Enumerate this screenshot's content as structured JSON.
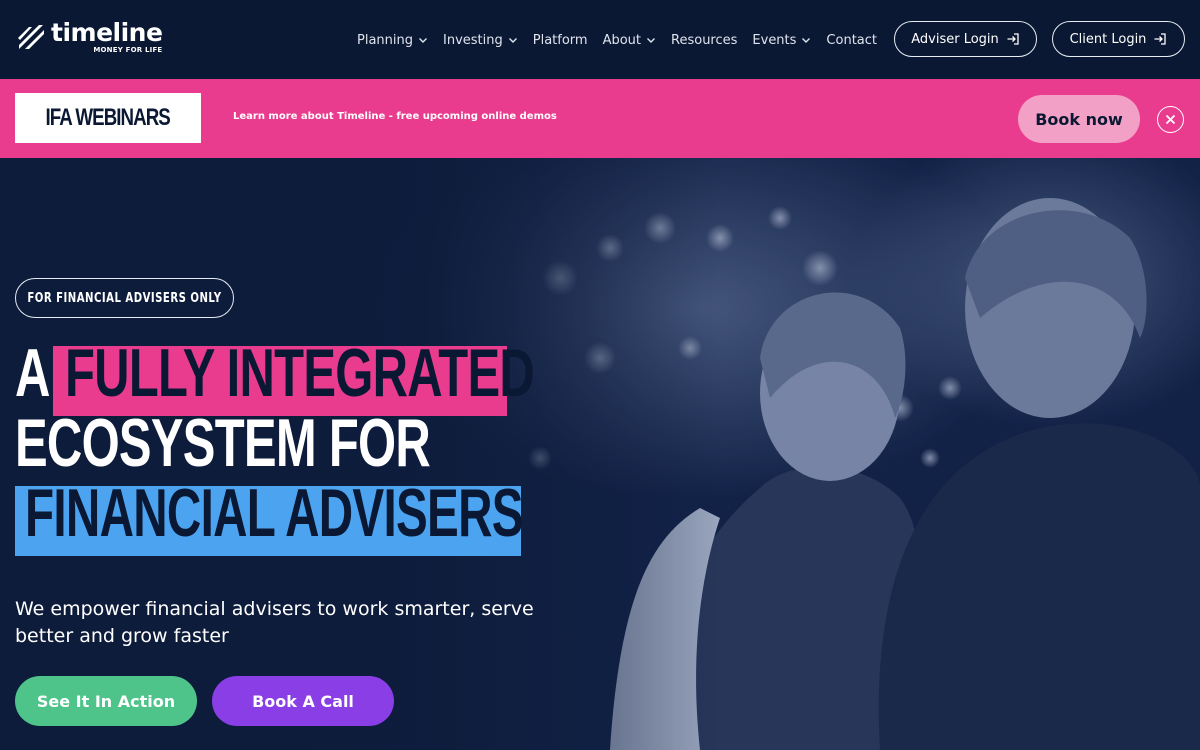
{
  "brand": {
    "name": "timeline",
    "tagline": "MONEY FOR LIFE"
  },
  "nav": {
    "items": [
      {
        "label": "Planning",
        "has_dropdown": true
      },
      {
        "label": "Investing",
        "has_dropdown": true
      },
      {
        "label": "Platform",
        "has_dropdown": false
      },
      {
        "label": "About",
        "has_dropdown": true
      },
      {
        "label": "Resources",
        "has_dropdown": false
      },
      {
        "label": "Events",
        "has_dropdown": true
      },
      {
        "label": "Contact",
        "has_dropdown": false
      }
    ],
    "adviser_login": "Adviser Login",
    "client_login": "Client Login"
  },
  "banner": {
    "tag": "IFA WEBINARS",
    "text": "Learn more about Timeline - free upcoming online demos",
    "cta": "Book now",
    "close_icon": "close-icon",
    "background": "#ea3c8e"
  },
  "hero": {
    "eyebrow": "FOR FINANCIAL ADVISERS ONLY",
    "headline": {
      "line1_prefix": "A",
      "line1_highlight": "FULLY INTEGRATED",
      "line2": "ECOSYSTEM FOR",
      "line3_highlight": "FINANCIAL ADVISERS"
    },
    "subtitle": "We empower financial advisers to work smarter, serve better and grow faster",
    "cta_primary": "See It In Action",
    "cta_secondary": "Book A Call"
  },
  "colors": {
    "navy": "#0b1833",
    "pink": "#ea3c8e",
    "blue": "#4ca3f0",
    "green": "#4ec48a",
    "purple": "#8a3ee6"
  }
}
